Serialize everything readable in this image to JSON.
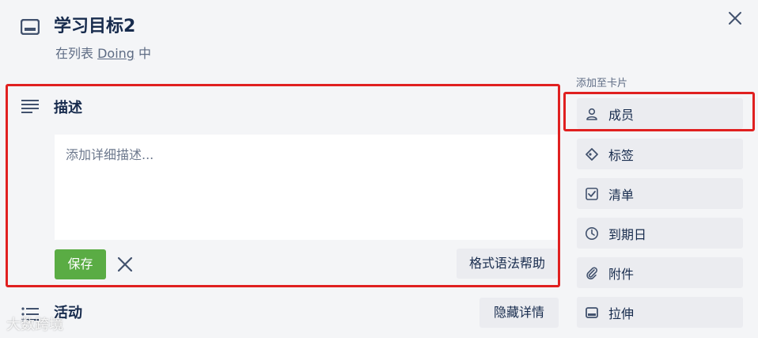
{
  "card": {
    "title": "学习目标2",
    "list_prefix": "在列表 ",
    "list_name": "Doing",
    "list_suffix": " 中"
  },
  "description": {
    "heading": "描述",
    "placeholder": "添加详细描述...",
    "save_label": "保存",
    "format_help_label": "格式语法帮助"
  },
  "activity": {
    "heading": "活动",
    "hide_details_label": "隐藏详情"
  },
  "sidebar": {
    "section_label": "添加至卡片",
    "items": [
      {
        "label": "成员",
        "icon": "member-icon"
      },
      {
        "label": "标签",
        "icon": "label-icon"
      },
      {
        "label": "清单",
        "icon": "checklist-icon"
      },
      {
        "label": "到期日",
        "icon": "clock-icon"
      },
      {
        "label": "附件",
        "icon": "paperclip-icon"
      },
      {
        "label": "拉伸",
        "icon": "cover-icon"
      }
    ]
  },
  "watermark": "大数跨境",
  "colors": {
    "save_green": "#5aac44",
    "highlight_red": "#e02020",
    "background": "#f4f5f7"
  }
}
